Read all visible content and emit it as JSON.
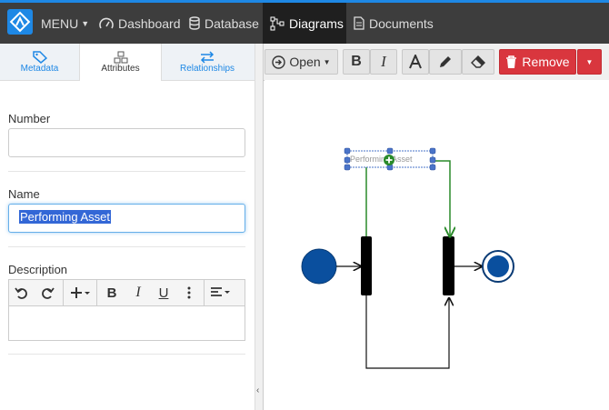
{
  "nav": {
    "menu_label": "MENU",
    "items": [
      {
        "label": "Dashboard",
        "icon": "gauge-icon"
      },
      {
        "label": "Database",
        "icon": "database-icon"
      },
      {
        "label": "Diagrams",
        "icon": "diagram-icon",
        "active": true
      },
      {
        "label": "Documents",
        "icon": "document-icon"
      }
    ],
    "accent_color": "#1e88e5"
  },
  "left_tabs": [
    {
      "label": "Metadata",
      "icon": "tag-icon"
    },
    {
      "label": "Attributes",
      "icon": "cubes-icon",
      "active": true
    },
    {
      "label": "Relationships",
      "icon": "swap-arrows-icon"
    }
  ],
  "form": {
    "number_label": "Number",
    "number_value": "",
    "name_label": "Name",
    "name_value": "Performing Asset",
    "description_label": "Description",
    "description_value": ""
  },
  "editor_toolbar": [
    "undo-icon",
    "redo-icon",
    "insert-plus-icon",
    "bold-icon",
    "italic-icon",
    "underline-icon",
    "more-vertical-icon",
    "align-icon"
  ],
  "diagram_toolbar": {
    "open_label": "Open",
    "remove_label": "Remove",
    "remove_color": "#d9363e"
  },
  "diagram": {
    "selected_label": "Performing Asset"
  }
}
